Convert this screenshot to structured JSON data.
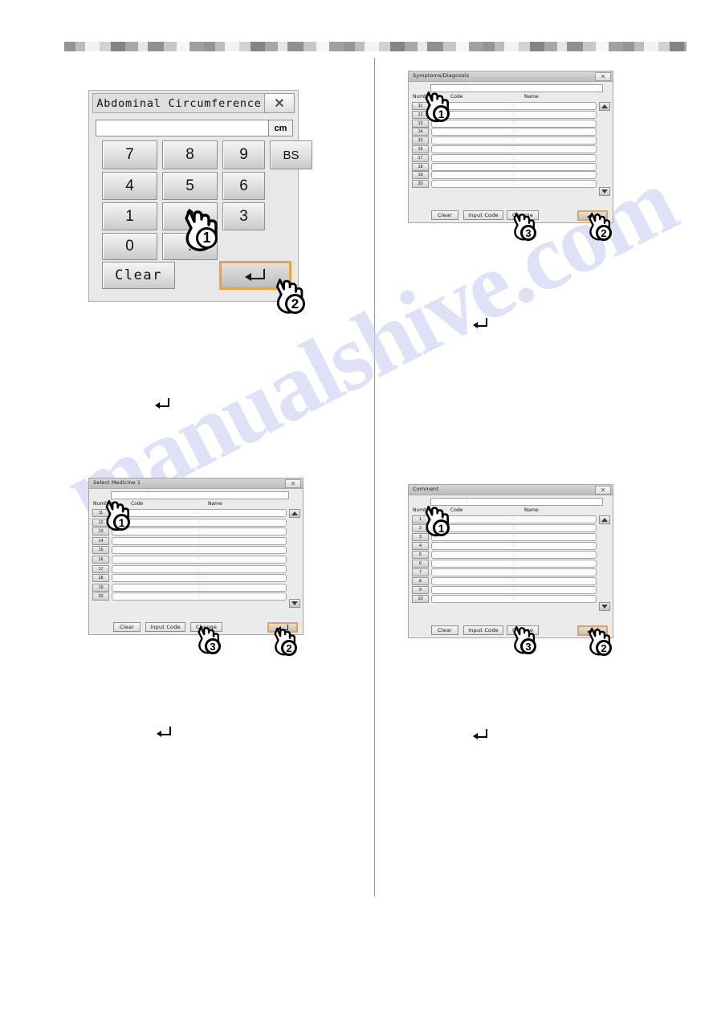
{
  "page": {
    "watermark": "manualshive.com"
  },
  "keypad_dialog": {
    "title": "Abdominal Circumference",
    "close_label": "✕",
    "input_value": "",
    "unit_label": "cm",
    "keys": [
      "7",
      "8",
      "9",
      "BS",
      "4",
      "5",
      "6",
      "1",
      "2",
      "3",
      "0",
      "."
    ],
    "clear_label": "Clear",
    "enter_label": "↵",
    "accent_color": "#e8a14c",
    "annotations": [
      {
        "number": "1",
        "target": "key-2"
      },
      {
        "number": "2",
        "target": "enter-button"
      }
    ]
  },
  "symptoms_dialog": {
    "title": "Symptoms/Diagnosis",
    "close_label": "✕",
    "search_value": ":",
    "columns": [
      "Number",
      "Code",
      "Name"
    ],
    "rows": [
      {
        "number": "11",
        "code": ":",
        "name": ""
      },
      {
        "number": "12",
        "code": ":",
        "name": ""
      },
      {
        "number": "13",
        "code": ":",
        "name": ""
      },
      {
        "number": "14",
        "code": ":",
        "name": ""
      },
      {
        "number": "15",
        "code": ":",
        "name": ""
      },
      {
        "number": "16",
        "code": ":",
        "name": ""
      },
      {
        "number": "17",
        "code": ":",
        "name": ""
      },
      {
        "number": "18",
        "code": ":",
        "name": ""
      },
      {
        "number": "19",
        "code": ":",
        "name": ""
      },
      {
        "number": "20",
        "code": ":",
        "name": ""
      }
    ],
    "buttons": {
      "clear": "Clear",
      "input_code": "Input Code",
      "change": "Change",
      "enter": "↵"
    },
    "scroll_up": "▲",
    "scroll_down": "▼",
    "annotations": [
      {
        "number": "1",
        "target": "row-number-11"
      },
      {
        "number": "2",
        "target": "enter-button"
      },
      {
        "number": "3",
        "target": "change-button"
      }
    ]
  },
  "medicine_dialog": {
    "title": "Select Medicine 1",
    "close_label": "✕",
    "search_value": ":",
    "columns": [
      "Number",
      "Code",
      "Name"
    ],
    "rows": [
      {
        "number": "11",
        "code": ":",
        "name": ""
      },
      {
        "number": "12",
        "code": ":",
        "name": ""
      },
      {
        "number": "13",
        "code": ":",
        "name": ""
      },
      {
        "number": "14",
        "code": ":",
        "name": ""
      },
      {
        "number": "15",
        "code": ":",
        "name": ""
      },
      {
        "number": "16",
        "code": ":",
        "name": ""
      },
      {
        "number": "17",
        "code": ":",
        "name": ""
      },
      {
        "number": "18",
        "code": ":",
        "name": ""
      },
      {
        "number": "19",
        "code": ":",
        "name": ""
      },
      {
        "number": "20",
        "code": ":",
        "name": ""
      }
    ],
    "buttons": {
      "clear": "Clear",
      "input_code": "Input Code",
      "change": "Change",
      "enter": "↵"
    },
    "scroll_up": "▲",
    "scroll_down": "▼",
    "annotations": [
      {
        "number": "1",
        "target": "row-number-11"
      },
      {
        "number": "2",
        "target": "enter-button"
      },
      {
        "number": "3",
        "target": "change-button"
      }
    ]
  },
  "comment_dialog": {
    "title": "Comment",
    "close_label": "✕",
    "search_value": ":",
    "columns": [
      "Number",
      "Code",
      "Name"
    ],
    "rows": [
      {
        "number": "1",
        "code": ":",
        "name": ""
      },
      {
        "number": "2",
        "code": ":",
        "name": ""
      },
      {
        "number": "3",
        "code": ":",
        "name": ""
      },
      {
        "number": "4",
        "code": ":",
        "name": ""
      },
      {
        "number": "5",
        "code": ":",
        "name": ""
      },
      {
        "number": "6",
        "code": ":",
        "name": ""
      },
      {
        "number": "7",
        "code": ":",
        "name": ""
      },
      {
        "number": "8",
        "code": ":",
        "name": ""
      },
      {
        "number": "9",
        "code": ":",
        "name": ""
      },
      {
        "number": "10",
        "code": ":",
        "name": ""
      }
    ],
    "buttons": {
      "clear": "Clear",
      "input_code": "Input Code",
      "change": "Change",
      "enter": "↵"
    },
    "scroll_up": "▲",
    "scroll_down": "▼",
    "annotations": [
      {
        "number": "1",
        "target": "row-number-1"
      },
      {
        "number": "2",
        "target": "enter-button"
      },
      {
        "number": "3",
        "target": "change-button"
      }
    ]
  },
  "inline_return_arrows": [
    {
      "id": "arrow-left-upper"
    },
    {
      "id": "arrow-right-upper"
    },
    {
      "id": "arrow-left-lower"
    },
    {
      "id": "arrow-right-lower"
    }
  ]
}
